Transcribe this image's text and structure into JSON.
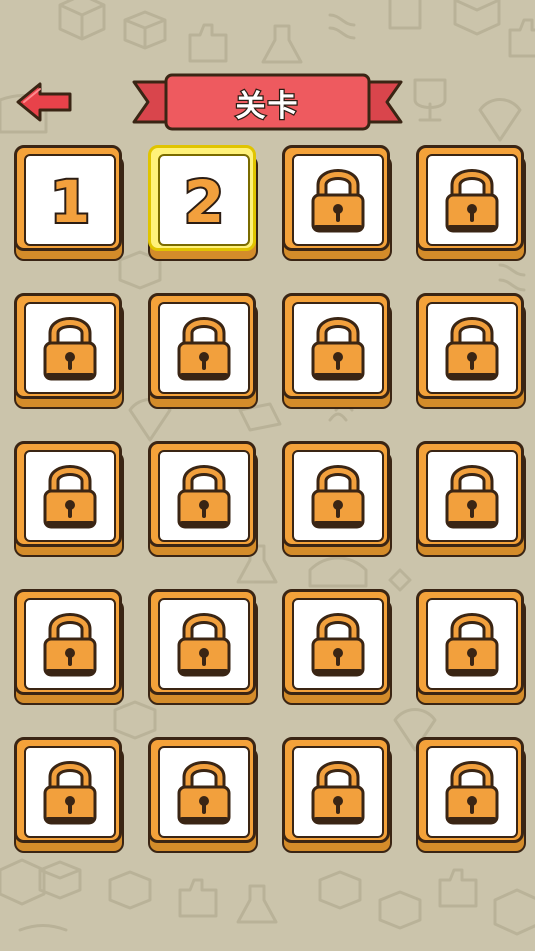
{
  "header": {
    "title": "关卡",
    "back_icon": "arrow-left-icon"
  },
  "colors": {
    "background": "#cbc4ab",
    "banner_red": "#ee5a5f",
    "tile_orange": "#f4a23a",
    "current_yellow": "#fff27a",
    "outline": "#3a2514"
  },
  "levels": [
    {
      "label": "1",
      "state": "unlocked"
    },
    {
      "label": "2",
      "state": "current"
    },
    {
      "label": "",
      "state": "locked",
      "icon": "lock-icon"
    },
    {
      "label": "",
      "state": "locked",
      "icon": "lock-icon"
    },
    {
      "label": "",
      "state": "locked",
      "icon": "lock-icon"
    },
    {
      "label": "",
      "state": "locked",
      "icon": "lock-icon"
    },
    {
      "label": "",
      "state": "locked",
      "icon": "lock-icon"
    },
    {
      "label": "",
      "state": "locked",
      "icon": "lock-icon"
    },
    {
      "label": "",
      "state": "locked",
      "icon": "lock-icon"
    },
    {
      "label": "",
      "state": "locked",
      "icon": "lock-icon"
    },
    {
      "label": "",
      "state": "locked",
      "icon": "lock-icon"
    },
    {
      "label": "",
      "state": "locked",
      "icon": "lock-icon"
    },
    {
      "label": "",
      "state": "locked",
      "icon": "lock-icon"
    },
    {
      "label": "",
      "state": "locked",
      "icon": "lock-icon"
    },
    {
      "label": "",
      "state": "locked",
      "icon": "lock-icon"
    },
    {
      "label": "",
      "state": "locked",
      "icon": "lock-icon"
    },
    {
      "label": "",
      "state": "locked",
      "icon": "lock-icon"
    },
    {
      "label": "",
      "state": "locked",
      "icon": "lock-icon"
    },
    {
      "label": "",
      "state": "locked",
      "icon": "lock-icon"
    },
    {
      "label": "",
      "state": "locked",
      "icon": "lock-icon"
    }
  ]
}
